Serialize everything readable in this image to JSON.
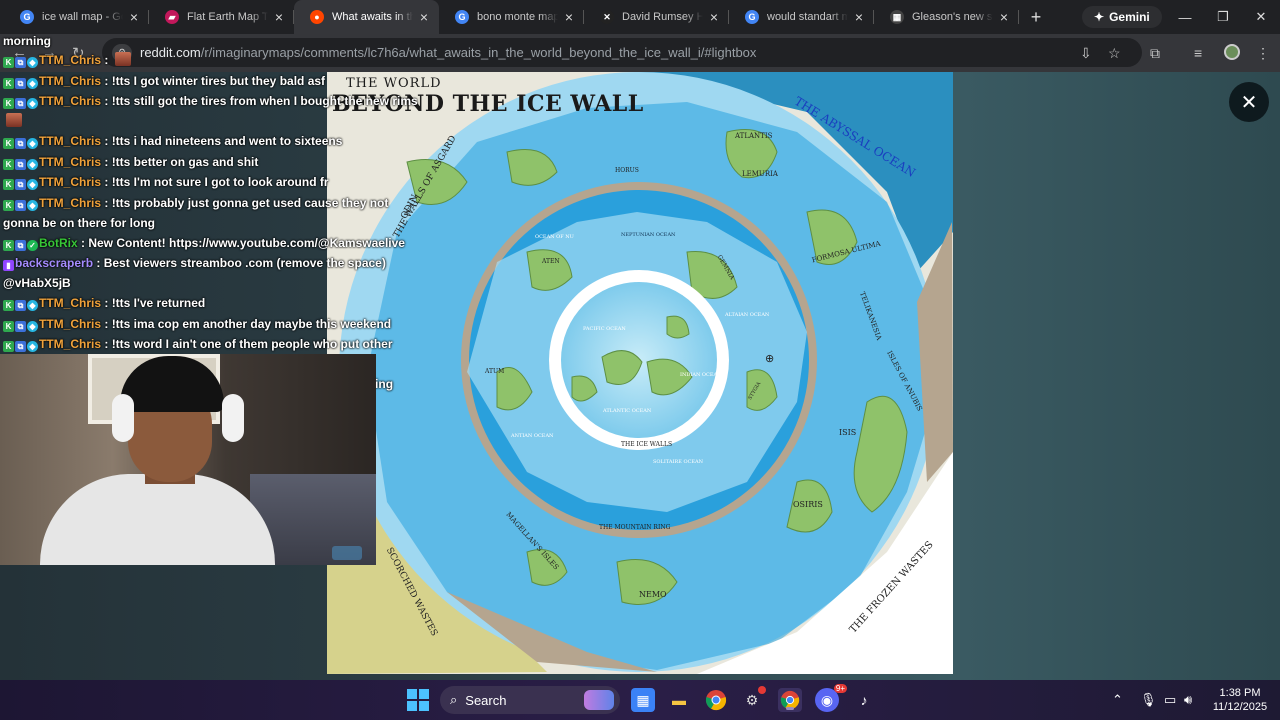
{
  "browser": {
    "tabs": [
      {
        "label": "ice wall map - Google",
        "favicon": "google-icon",
        "active": false
      },
      {
        "label": "Flat Earth Map Terr",
        "favicon": "flat-earth-favicon",
        "active": false
      },
      {
        "label": "What awaits in the",
        "favicon": "reddit-icon",
        "active": true
      },
      {
        "label": "bono monte map",
        "favicon": "google-icon",
        "active": false
      },
      {
        "label": "David Rumsey Hist",
        "favicon": "rumsey-icon",
        "active": false
      },
      {
        "label": "would standart ma",
        "favicon": "google-icon",
        "active": false
      },
      {
        "label": "Gleason's new stan",
        "favicon": "map-icon",
        "active": false
      }
    ],
    "gemini_label": "Gemini",
    "url_host": "reddit.com",
    "url_path": "/r/imaginarymaps/comments/lc7h6a/what_awaits_in_the_world_beyond_the_ice_wall_i/#lightbox"
  },
  "map": {
    "title_line1": "THE WORLD",
    "title_line2": "BEYOND THE ICE WALL",
    "labels": {
      "abyssal": "THE ABYSSAL OCEAN",
      "asgard": "THE WALLS OF ASGARD",
      "odin": "ODIN",
      "atlantis": "ATLANTIS",
      "lemuria": "LEMURIA",
      "horus": "HORUS",
      "formosa": "FORMOSA ULTIMA",
      "telikanesia": "TELIKANESIA",
      "anubis": "ISLES OF ANUBIS",
      "isis": "ISIS",
      "osiris": "OSIRIS",
      "frozen": "THE FROZEN WASTES",
      "scorched": "SCORCHED WASTES",
      "magellan": "MAGELLAN'S ISLES",
      "nemo": "NEMO",
      "mountain_ring": "THE MOUNTAIN RING",
      "ice_walls": "THE ICE WALLS",
      "solitaire": "SOLITAIRE OCEAN",
      "neptunian": "NEPTUNIAN OCEAN",
      "ocean_nu": "OCEAN OF NU",
      "aten": "ATEN",
      "gemnia": "GEMNIA",
      "altaian": "ALTAIAN OCEAN",
      "atum": "ATUM",
      "antian": "ANTIAN OCEAN",
      "pacific": "PACIFIC OCEAN",
      "indian": "INDIAN OCEAN",
      "atlantic": "ATLANTIC OCEAN",
      "stygia": "STYGIA"
    }
  },
  "chat": {
    "top_line": "morning",
    "messages": [
      {
        "user": "TTM_Chris",
        "cls": "u-chris",
        "badges": [
          "k",
          "p",
          "d"
        ],
        "text": "",
        "emote": true
      },
      {
        "user": "TTM_Chris",
        "cls": "u-chris",
        "badges": [
          "k",
          "p",
          "d"
        ],
        "text": "!tts I got winter tires but they bald asf",
        "emote": false
      },
      {
        "user": "TTM_Chris",
        "cls": "u-chris",
        "badges": [
          "k",
          "p",
          "d"
        ],
        "text": "!tts still got the tires from when I bought the new rims",
        "emote": true
      },
      {
        "user": "TTM_Chris",
        "cls": "u-chris",
        "badges": [
          "k",
          "p",
          "d"
        ],
        "text": "!tts i had nineteens and went to sixteens",
        "emote": false
      },
      {
        "user": "TTM_Chris",
        "cls": "u-chris",
        "badges": [
          "k",
          "p",
          "d"
        ],
        "text": "!tts better on gas and shit",
        "emote": false
      },
      {
        "user": "TTM_Chris",
        "cls": "u-chris",
        "badges": [
          "k",
          "p",
          "d"
        ],
        "text": "!tts I'm not sure I got to look around fr",
        "emote": false
      },
      {
        "user": "TTM_Chris",
        "cls": "u-chris",
        "badges": [
          "k",
          "p",
          "d"
        ],
        "text": "!tts probably just gonna get used cause they not gonna be on there for long",
        "emote": false
      },
      {
        "user": "BotRix",
        "cls": "u-bot",
        "badges": [
          "k",
          "p",
          "c"
        ],
        "text": "New Content! https://www.youtube.com/@Kamswaelive",
        "emote": false
      },
      {
        "user": "backscraperb",
        "cls": "u-back",
        "badges": [
          "s"
        ],
        "text": "Best viewers streamboo .com (remove the space) @vHabX5jB",
        "emote": false
      },
      {
        "user": "TTM_Chris",
        "cls": "u-chris",
        "badges": [
          "k",
          "p",
          "d"
        ],
        "text": "!tts I've returned",
        "emote": false
      },
      {
        "user": "TTM_Chris",
        "cls": "u-chris",
        "badges": [
          "k",
          "p",
          "d"
        ],
        "text": "!tts ima cop em another day maybe this weekend",
        "emote": false
      },
      {
        "user": "TTM_Chris",
        "cls": "u-chris",
        "badges": [
          "k",
          "p",
          "d"
        ],
        "text": "!tts word I ain't one of them people who put other peoples life in danger",
        "emote": true
      },
      {
        "user": "TTM_Chris",
        "cls": "u-chris",
        "badges": [
          "k",
          "p",
          "d"
        ],
        "text": "!tts what about global warming tho i was thinking bout it",
        "emote": false
      }
    ]
  },
  "taskbar": {
    "search_label": "Search",
    "time": "1:38 PM",
    "date": "11/12/2025",
    "discord_badge": "9+"
  },
  "colors": {
    "reddit": "#ff4500",
    "google": "#4285f4",
    "chris": "#f0a23b",
    "bot": "#37c637",
    "back": "#a58cff",
    "ocean_deep": "#1e9fdb",
    "ocean_light": "#a6dcf2",
    "land": "#8fc26a",
    "mountain": "#b5a58f"
  }
}
